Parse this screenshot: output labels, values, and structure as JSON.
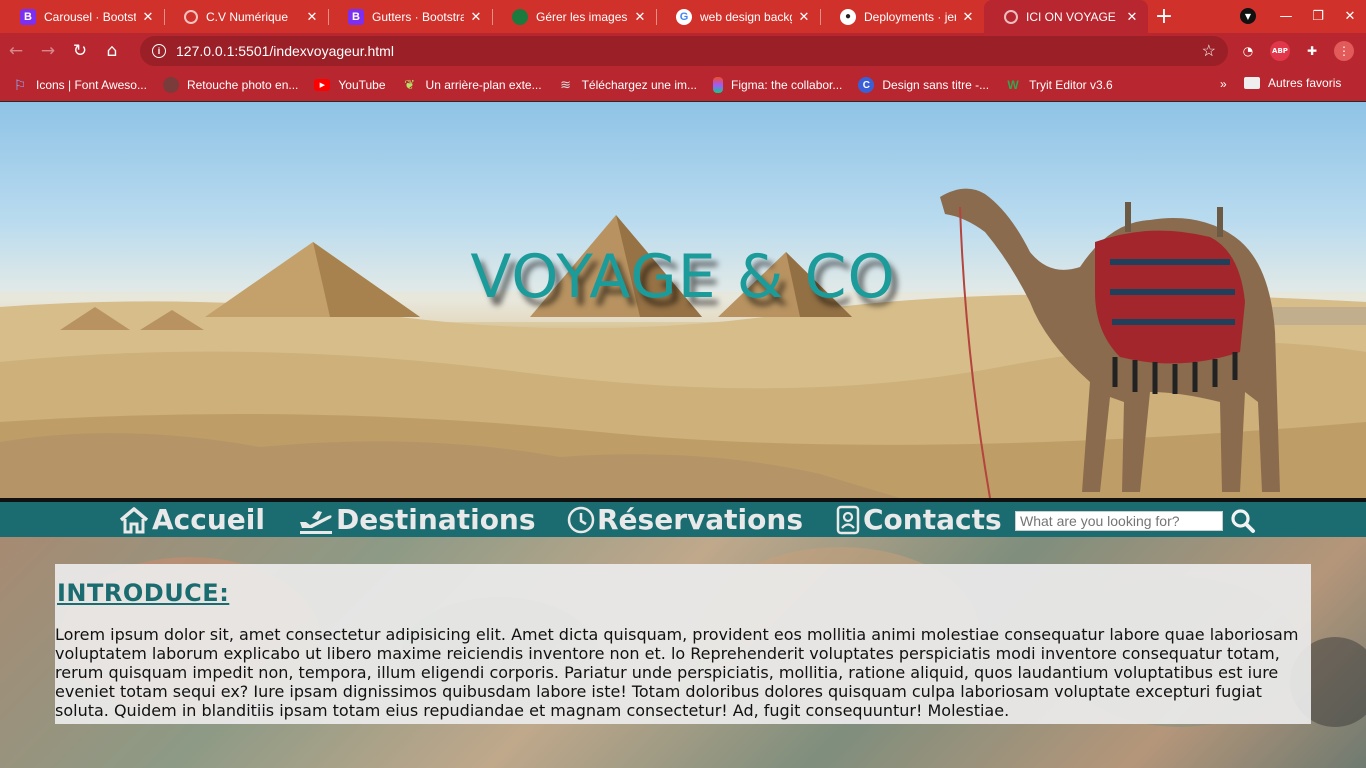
{
  "browser": {
    "tabs": [
      {
        "title": "Carousel · Bootstrap",
        "favicon": "B",
        "active": false
      },
      {
        "title": "C.V Numérique",
        "favicon": "",
        "active": false
      },
      {
        "title": "Gutters · Bootstrap",
        "favicon": "B",
        "active": false
      },
      {
        "title": "Gérer les images et",
        "favicon": "",
        "active": false
      },
      {
        "title": "web design backgr",
        "favicon": "G",
        "active": false
      },
      {
        "title": "Deployments · jere",
        "favicon": "",
        "active": false
      },
      {
        "title": "ICI ON VOYAGE",
        "favicon": "",
        "active": true
      }
    ],
    "new_tab_label": "+",
    "url": "127.0.0.1:5501/indexvoyageur.html",
    "ext_abp": "ABP",
    "bookmarks": [
      {
        "label": "Icons | Font Aweso..."
      },
      {
        "label": "Retouche photo en..."
      },
      {
        "label": "YouTube"
      },
      {
        "label": "Un arrière-plan exte..."
      },
      {
        "label": "Téléchargez une im..."
      },
      {
        "label": "Figma: the collabor..."
      },
      {
        "label": "Design sans titre -..."
      },
      {
        "label": "Tryit Editor v3.6"
      }
    ],
    "bookmarks_more": "»",
    "other_bookmarks": "Autres favoris"
  },
  "hero": {
    "title": "VOYAGE & CO"
  },
  "nav": {
    "items": [
      {
        "label": "Accueil",
        "icon": "home-icon"
      },
      {
        "label": "Destinations",
        "icon": "plane-departure-icon"
      },
      {
        "label": "Réservations",
        "icon": "clock-icon"
      },
      {
        "label": "Contacts",
        "icon": "contact-card-icon"
      }
    ],
    "search_placeholder": "What are you looking for?"
  },
  "intro": {
    "title": "INTRODUCE:",
    "text": "Lorem ipsum dolor sit, amet consectetur adipisicing elit. Amet dicta quisquam, provident eos mollitia animi molestiae consequatur labore quae laboriosam voluptatem laborum explicabo ut libero maxime reiciendis inventore non et. lo Reprehenderit voluptates perspiciatis modi inventore consequatur totam, rerum quisquam impedit non, tempora, illum eligendi corporis. Pariatur unde perspiciatis, mollitia, ratione aliquid, quos laudantium voluptatibus est iure eveniet totam sequi ex? Iure ipsam dignissimos quibusdam labore iste! Totam doloribus dolores quisquam culpa laboriosam voluptate excepturi fugiat soluta. Quidem in blanditiis ipsam totam eius repudiandae et magnam consectetur! Ad, fugit consequuntur! Molestiae."
  },
  "colors": {
    "chrome": "#b8262f",
    "tabstrip": "#d0322b",
    "accent_teal": "#1a6c70",
    "title_teal": "#1c9b9b"
  }
}
